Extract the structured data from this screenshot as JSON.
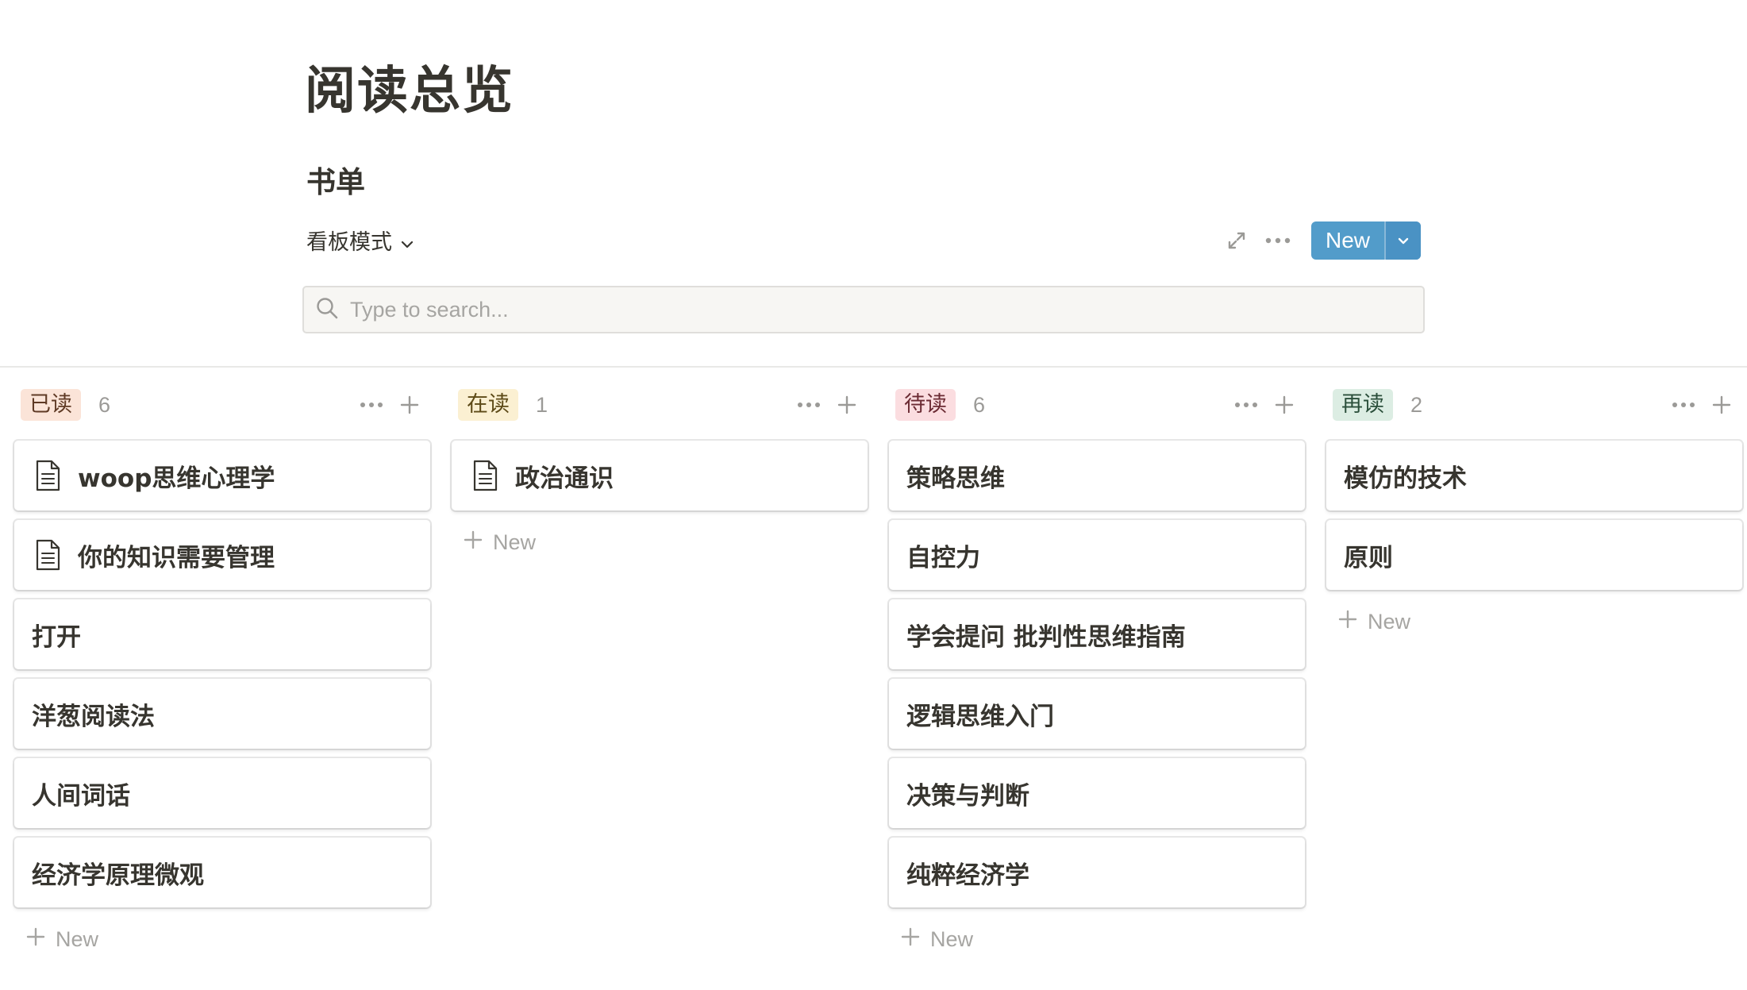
{
  "page": {
    "title": "阅读总览"
  },
  "database": {
    "title": "书单",
    "view_label": "看板模式",
    "new_label": "New",
    "search_placeholder": "Type to search..."
  },
  "icons": {
    "expand": "expand-icon",
    "more": "more-horizontal-icon",
    "chevron": "chevron-down-icon",
    "search": "search-icon",
    "plus": "plus-icon",
    "document": "document-icon"
  },
  "colors": {
    "accent": "#529cca",
    "text": "#37352f",
    "muted": "#9b9a97"
  },
  "columns": [
    {
      "name": "已读",
      "count": "6",
      "tag_bg": "#fbe4d8",
      "tag_fg": "#5f3a25",
      "cards": [
        {
          "title": "woop思维心理学",
          "has_icon": true
        },
        {
          "title": "你的知识需要管理",
          "has_icon": true
        },
        {
          "title": "打开",
          "has_icon": false
        },
        {
          "title": "洋葱阅读法",
          "has_icon": false
        },
        {
          "title": "人间词话",
          "has_icon": false
        },
        {
          "title": "经济学原理微观",
          "has_icon": false
        }
      ],
      "new_label": "New"
    },
    {
      "name": "在读",
      "count": "1",
      "tag_bg": "#fbf0d2",
      "tag_fg": "#5d4a17",
      "cards": [
        {
          "title": "政治通识",
          "has_icon": true
        }
      ],
      "new_label": "New"
    },
    {
      "name": "待读",
      "count": "6",
      "tag_bg": "#fbdde0",
      "tag_fg": "#6b2b33",
      "cards": [
        {
          "title": "策略思维",
          "has_icon": false
        },
        {
          "title": "自控力",
          "has_icon": false
        },
        {
          "title": "学会提问 批判性思维指南",
          "has_icon": false
        },
        {
          "title": "逻辑思维入门",
          "has_icon": false
        },
        {
          "title": "决策与判断",
          "has_icon": false
        },
        {
          "title": "纯粹经济学",
          "has_icon": false
        }
      ],
      "new_label": "New"
    },
    {
      "name": "再读",
      "count": "2",
      "tag_bg": "#dcede3",
      "tag_fg": "#2b4f3b",
      "cards": [
        {
          "title": "模仿的技术",
          "has_icon": false
        },
        {
          "title": "原则",
          "has_icon": false
        }
      ],
      "new_label": "New"
    }
  ]
}
